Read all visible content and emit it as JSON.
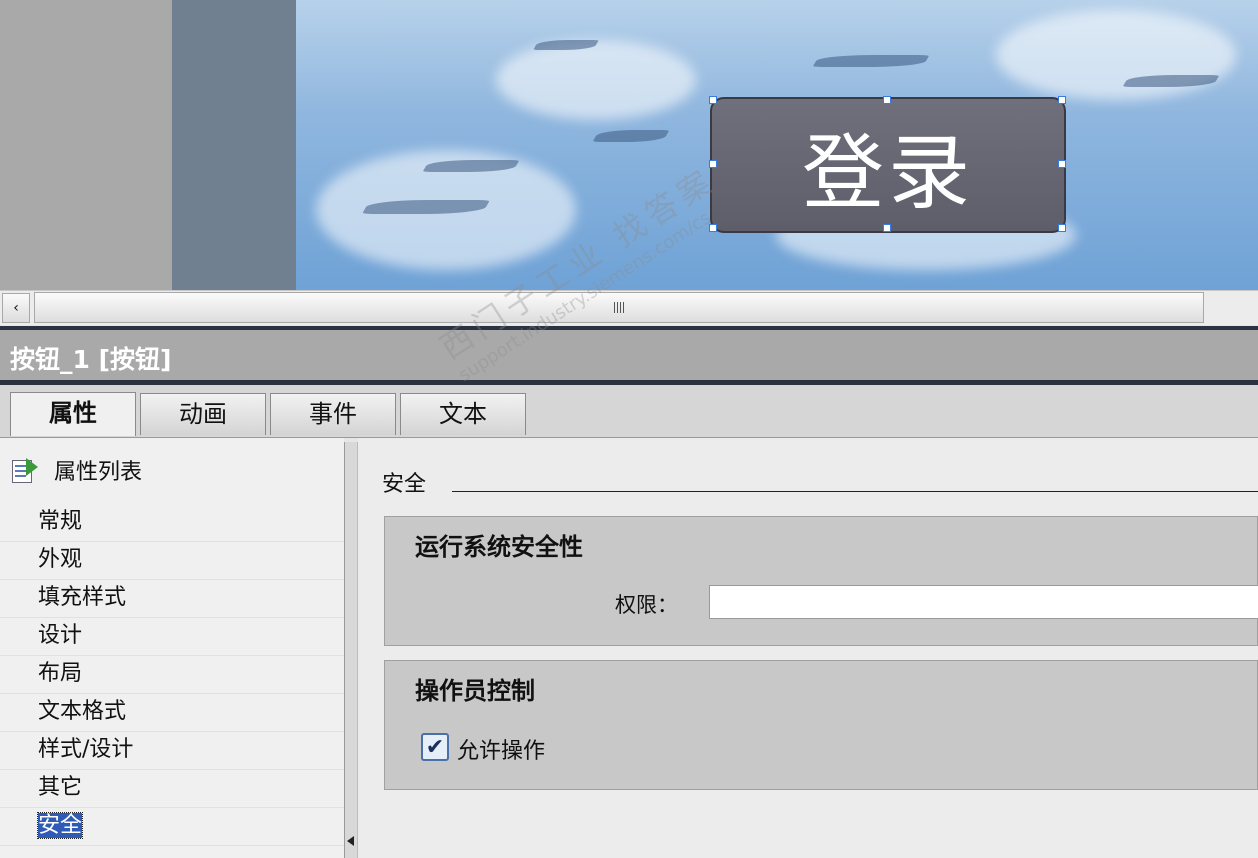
{
  "canvas": {
    "button_text": "登录",
    "colors": {
      "sidebar_gray": "#a9a9a9",
      "slate": "#708090",
      "sky": "#8fb6de",
      "button": "#66666f"
    }
  },
  "inspector": {
    "title": "按钮_1 [按钮]",
    "tabs": [
      {
        "label": "属性",
        "active": true
      },
      {
        "label": "动画",
        "active": false
      },
      {
        "label": "事件",
        "active": false
      },
      {
        "label": "文本",
        "active": false
      }
    ],
    "property_list_label": "属性列表",
    "nav_items": [
      "常规",
      "外观",
      "填充样式",
      "设计",
      "布局",
      "文本格式",
      "样式/设计",
      "其它",
      "安全"
    ],
    "selected_nav": "安全",
    "section_title": "安全",
    "runtime_security": {
      "title": "运行系统安全性",
      "permission_label": "权限：",
      "permission_value": ""
    },
    "operator_control": {
      "title": "操作员控制",
      "allow_operation_label": "允许操作",
      "allow_operation_checked": true
    }
  },
  "watermark": {
    "line1": "西门子工业  找答案",
    "line2": "support.industry.siemens.com/cs"
  }
}
